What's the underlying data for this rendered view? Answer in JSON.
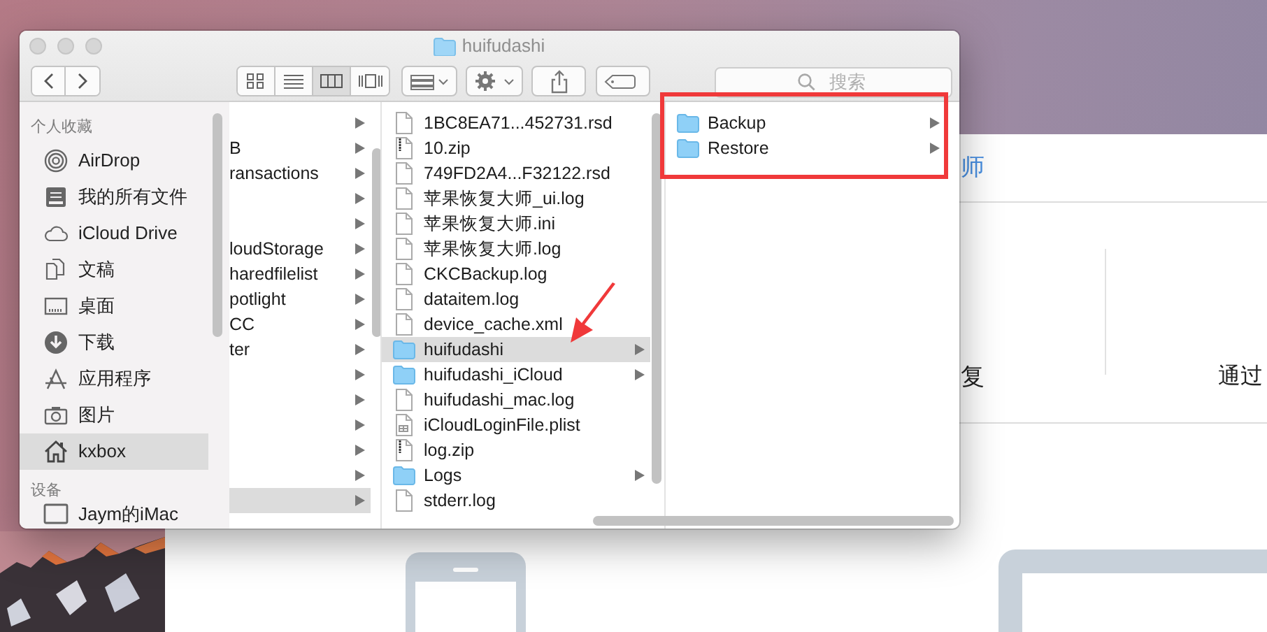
{
  "window": {
    "title": "huifudashi"
  },
  "toolbar": {
    "view_buttons": [
      {
        "kind": "icons",
        "selected": false
      },
      {
        "kind": "list",
        "selected": false
      },
      {
        "kind": "columns",
        "selected": true
      },
      {
        "kind": "cover",
        "selected": false
      }
    ],
    "search": {
      "placeholder": "搜索"
    }
  },
  "sidebar": {
    "sections": [
      {
        "title": "个人收藏",
        "items": [
          {
            "label": "AirDrop",
            "kind": "airdrop",
            "selected": false
          },
          {
            "label": "我的所有文件",
            "kind": "allfiles",
            "selected": false
          },
          {
            "label": "iCloud Drive",
            "kind": "cloud",
            "selected": false
          },
          {
            "label": "文稿",
            "kind": "documents",
            "selected": false
          },
          {
            "label": "桌面",
            "kind": "desktop",
            "selected": false
          },
          {
            "label": "下载",
            "kind": "downloads",
            "selected": false
          },
          {
            "label": "应用程序",
            "kind": "apps",
            "selected": false
          },
          {
            "label": "图片",
            "kind": "pictures",
            "selected": false
          },
          {
            "label": "kxbox",
            "kind": "home",
            "selected": true
          }
        ]
      },
      {
        "title": "设备",
        "items": [
          {
            "label": "Jaym的iMac",
            "kind": "computer",
            "selected": false
          }
        ]
      }
    ]
  },
  "columns": [
    {
      "items": [
        {
          "has_children": true,
          "selected": false
        },
        {
          "label": "B",
          "has_children": true,
          "selected": false
        },
        {
          "label": "ransactions",
          "has_children": true,
          "selected": false
        },
        {
          "has_children": true,
          "selected": false
        },
        {
          "has_children": true,
          "selected": false
        },
        {
          "label": "loudStorage",
          "has_children": true,
          "selected": false
        },
        {
          "label": "haredfilelist",
          "has_children": true,
          "selected": false
        },
        {
          "label": "potlight",
          "has_children": true,
          "selected": false
        },
        {
          "label": "CC",
          "has_children": true,
          "selected": false
        },
        {
          "label": "ter",
          "has_children": true,
          "selected": false
        },
        {
          "has_children": true,
          "selected": false
        },
        {
          "has_children": true,
          "selected": false
        },
        {
          "has_children": true,
          "selected": false
        },
        {
          "has_children": true,
          "selected": false
        },
        {
          "has_children": true,
          "selected": false
        },
        {
          "has_children": true,
          "selected": true
        }
      ]
    },
    {
      "items": [
        {
          "label": "1BC8EA71...452731.rsd",
          "kind": "file",
          "has_children": false,
          "selected": false
        },
        {
          "label": "10.zip",
          "kind": "zip",
          "has_children": false,
          "selected": false
        },
        {
          "label": "749FD2A4...F32122.rsd",
          "kind": "file",
          "has_children": false,
          "selected": false
        },
        {
          "label": "苹果恢复大师_ui.log",
          "kind": "file",
          "has_children": false,
          "selected": false
        },
        {
          "label": "苹果恢复大师.ini",
          "kind": "file",
          "has_children": false,
          "selected": false
        },
        {
          "label": "苹果恢复大师.log",
          "kind": "file",
          "has_children": false,
          "selected": false
        },
        {
          "label": "CKCBackup.log",
          "kind": "file",
          "has_children": false,
          "selected": false
        },
        {
          "label": "dataitem.log",
          "kind": "file",
          "has_children": false,
          "selected": false
        },
        {
          "label": "device_cache.xml",
          "kind": "file",
          "has_children": false,
          "selected": false
        },
        {
          "label": "huifudashi",
          "kind": "folder",
          "has_children": true,
          "selected": true
        },
        {
          "label": "huifudashi_iCloud",
          "kind": "folder",
          "has_children": true,
          "selected": false
        },
        {
          "label": "huifudashi_mac.log",
          "kind": "file",
          "has_children": false,
          "selected": false
        },
        {
          "label": "iCloudLoginFile.plist",
          "kind": "plist",
          "has_children": false,
          "selected": false
        },
        {
          "label": "log.zip",
          "kind": "zip",
          "has_children": false,
          "selected": false
        },
        {
          "label": "Logs",
          "kind": "folder",
          "has_children": true,
          "selected": false
        },
        {
          "label": "stderr.log",
          "kind": "file",
          "has_children": false,
          "selected": false
        }
      ]
    },
    {
      "items": [
        {
          "label": "Backup",
          "kind": "folder",
          "has_children": true,
          "selected": false
        },
        {
          "label": "Restore",
          "kind": "folder",
          "has_children": true,
          "selected": false
        }
      ]
    }
  ],
  "background_app": {
    "title_fragment": "师",
    "option_left": "复",
    "option_right": "通过"
  }
}
